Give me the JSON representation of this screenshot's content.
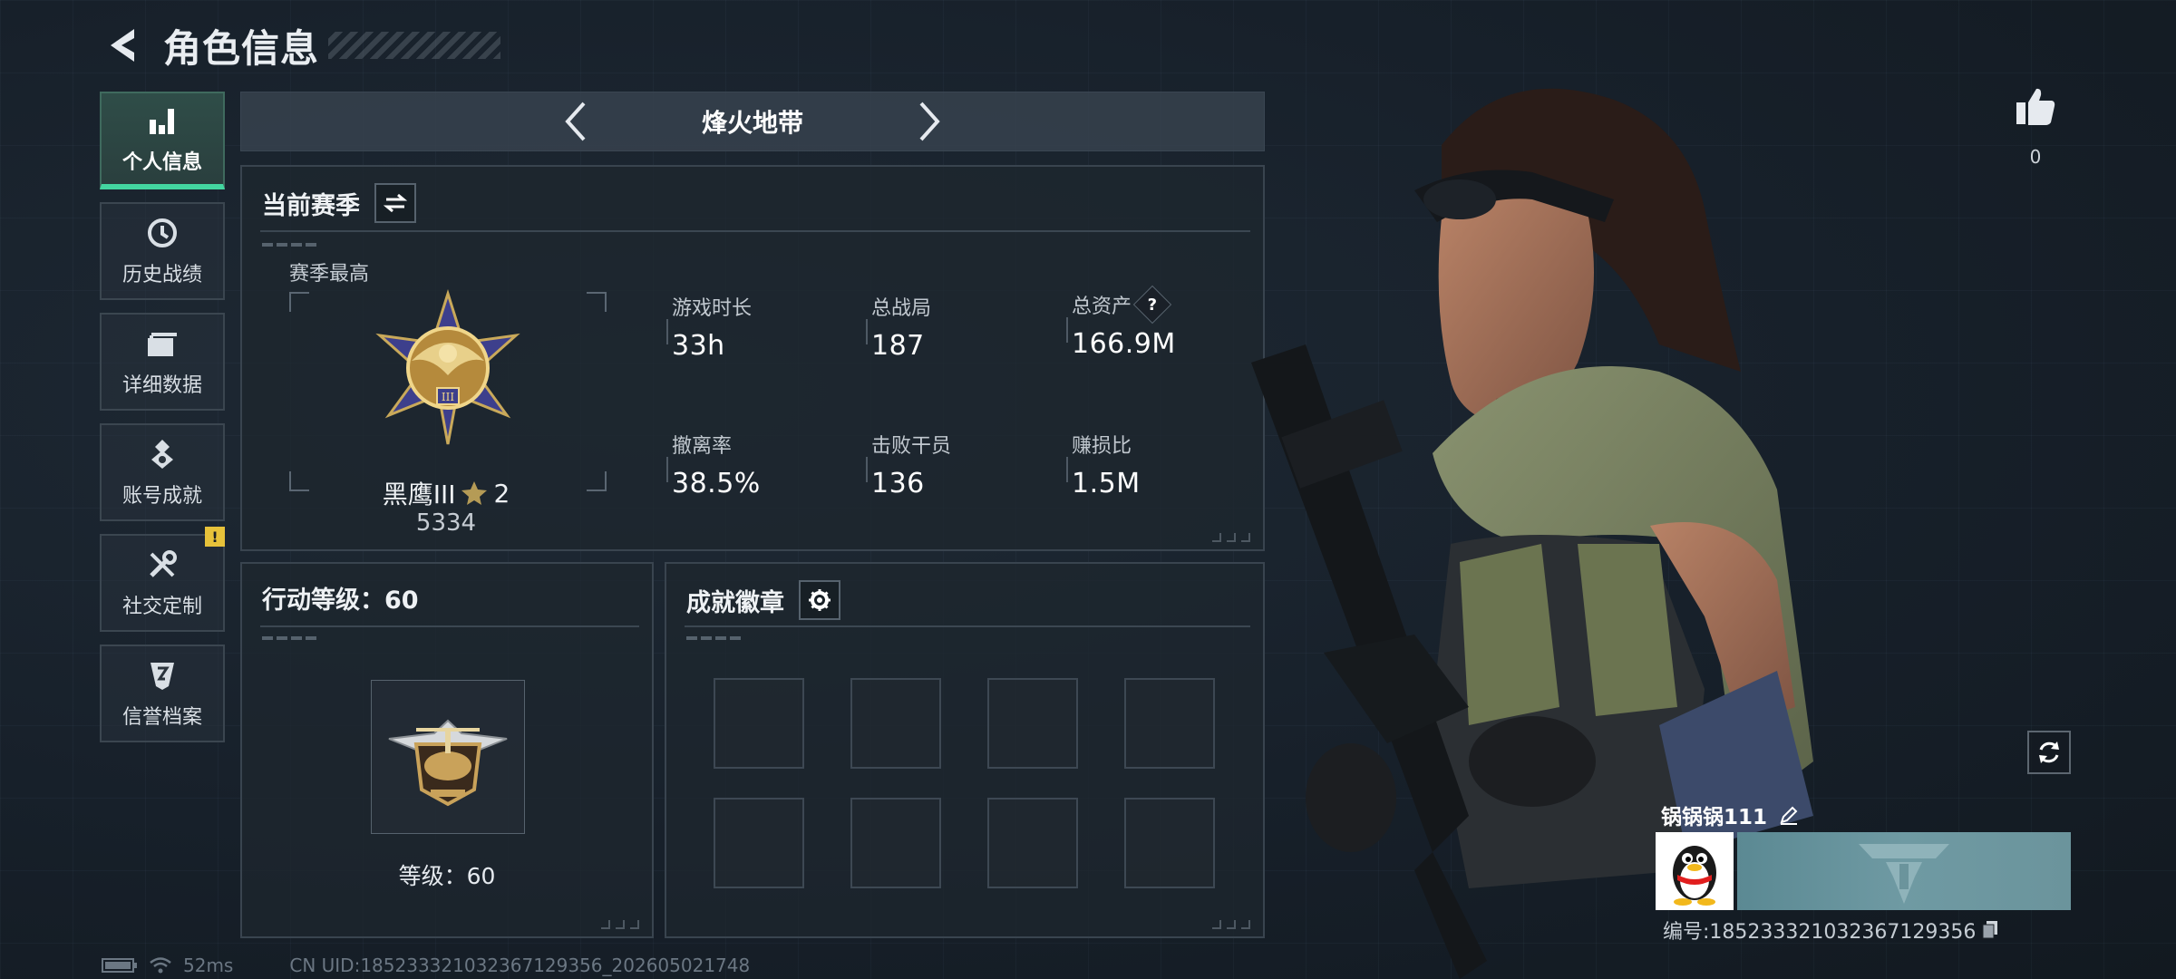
{
  "header": {
    "title": "角色信息"
  },
  "sidebar": {
    "items": [
      {
        "label": "个人信息",
        "icon": "bar-chart-icon",
        "active": true
      },
      {
        "label": "历史战绩",
        "icon": "history-clock-icon"
      },
      {
        "label": "详细数据",
        "icon": "folder-icon"
      },
      {
        "label": "账号成就",
        "icon": "achievement-icon"
      },
      {
        "label": "社交定制",
        "icon": "tools-icon",
        "badge": "!"
      },
      {
        "label": "信誉档案",
        "icon": "credit-shield-icon"
      }
    ]
  },
  "map": {
    "name": "烽火地带"
  },
  "season": {
    "title": "当前赛季",
    "best_label": "赛季最高",
    "rank_name": "黑鹰III",
    "rank_stars": "2",
    "rank_score": "5334",
    "stats": [
      {
        "label": "游戏时长",
        "value": "33h"
      },
      {
        "label": "总战局",
        "value": "187"
      },
      {
        "label": "总资产",
        "value": "166.9M",
        "help": "?"
      },
      {
        "label": "撤离率",
        "value": "38.5%"
      },
      {
        "label": "击败干员",
        "value": "136"
      },
      {
        "label": "赚损比",
        "value": "1.5M"
      }
    ]
  },
  "level_panel": {
    "title": "行动等级：60",
    "level_text": "等级：60"
  },
  "achievement_panel": {
    "title": "成就徽章",
    "slots": 8
  },
  "like": {
    "count": "0"
  },
  "player": {
    "name": "锅锅锅111",
    "id": "编号:1852333210323671293​56"
  },
  "status": {
    "ping": "52ms",
    "uid": "CN UID:185233321032367129356_202605021748"
  },
  "colors": {
    "accent": "#43d6a0",
    "badge": "#e7c23a",
    "banner": "#6b949c"
  }
}
